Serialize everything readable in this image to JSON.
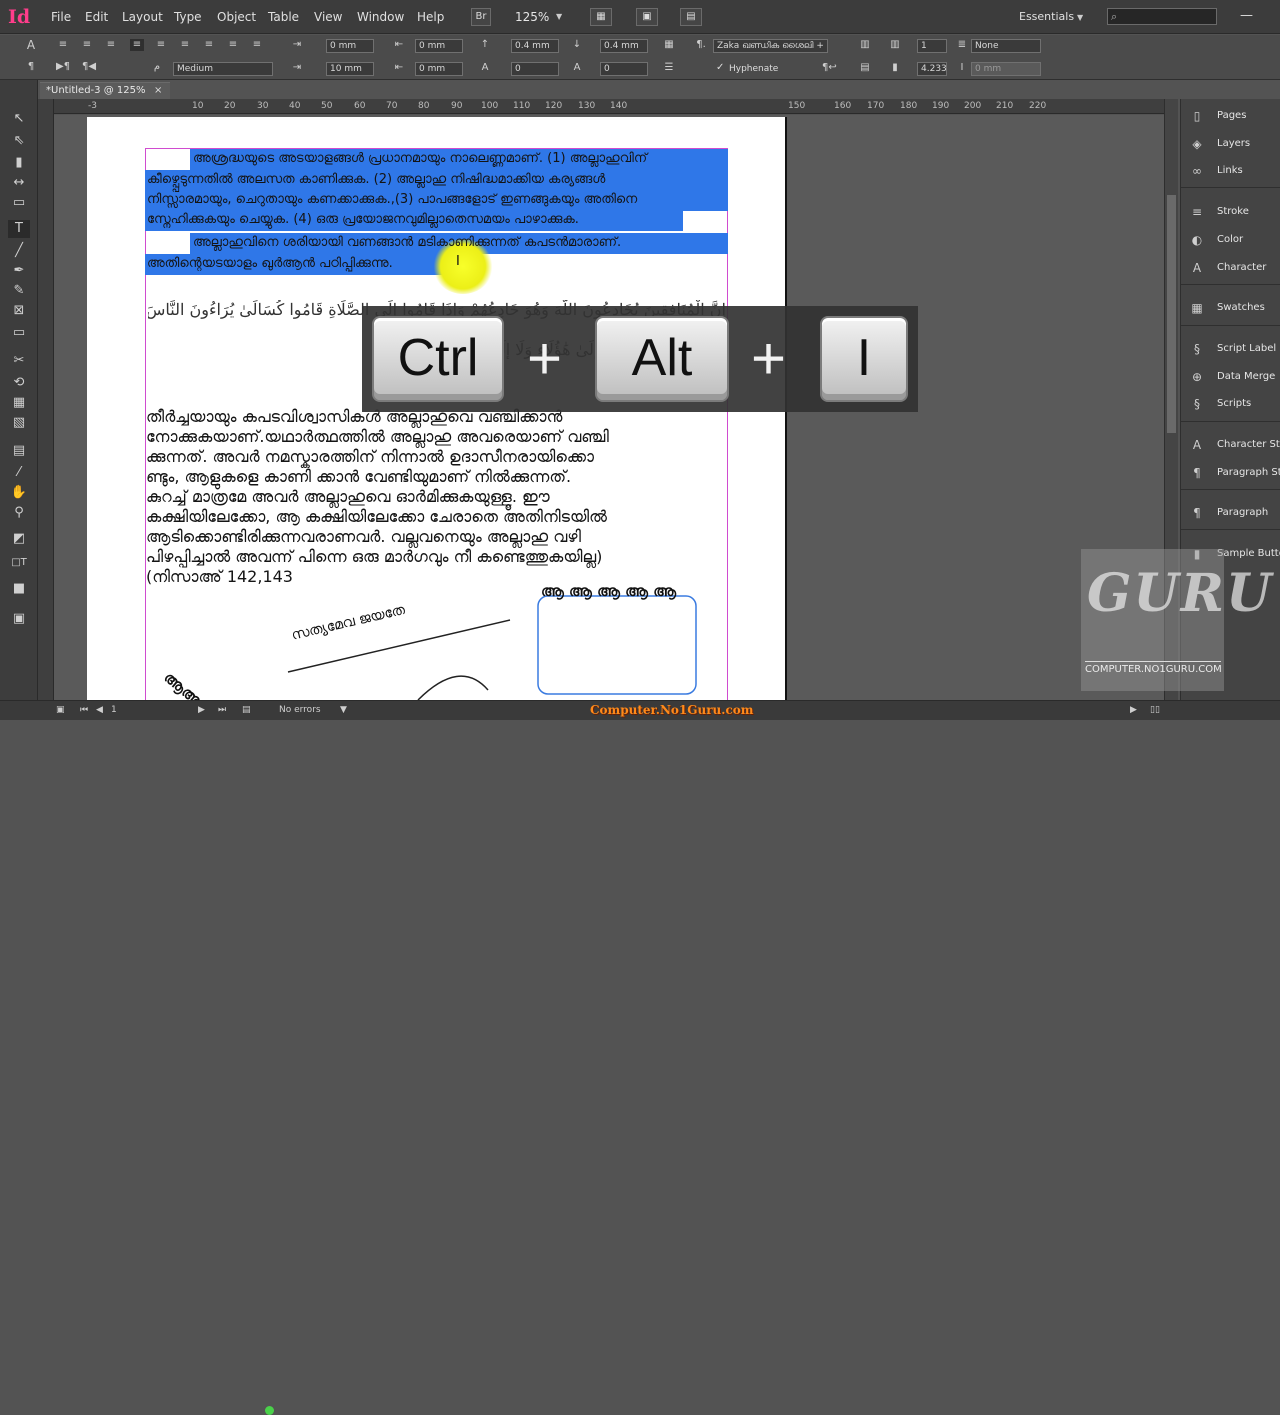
{
  "menubar": {
    "app_icon": "Id",
    "items": [
      "File",
      "Edit",
      "Layout",
      "Type",
      "Object",
      "Table",
      "View",
      "Window",
      "Help"
    ],
    "bridge_label": "Br",
    "zoom": "125%",
    "workspace": "Essentials"
  },
  "control_panel": {
    "font_style": "Medium",
    "left_indent": "0 mm",
    "right_indent": "0 mm",
    "first_line_indent": "10 mm",
    "last_line_indent": "0 mm",
    "space_before": "0.4 mm",
    "space_after": "0.4 mm",
    "drop_cap_lines": "0",
    "drop_cap_chars": "0",
    "paragraph_style": "Zaka ഖണ്ഡിക ശൈലി +",
    "hyphenate_label": "Hyphenate",
    "columns": "1",
    "gutter": "4.233",
    "span_mode": "None",
    "span_value": "0 mm"
  },
  "document": {
    "tab_title": "*Untitled-3 @ 125%",
    "ruler_ticks": [
      "-3",
      "10",
      "20",
      "30",
      "40",
      "50",
      "60",
      "70",
      "80",
      "90",
      "100",
      "110",
      "120",
      "130",
      "140",
      "150",
      "160",
      "170",
      "180",
      "190",
      "200",
      "210",
      "220"
    ]
  },
  "page_text": {
    "selected_lines": [
      "അശ്രദ്ധയുടെ അടയാളങ്ങൾ പ്രധാനമായും നാലെണ്ണമാണ്. (1) അല്ലാഹുവിന്",
      "കീഴ്പ്പെടുന്നതിൽ അലസത കാണിക്കുക. (2) അല്ലാഹു നിഷിദ്ധമാക്കിയ കര്യങ്ങൾ",
      "നിസ്സാരമായും, ചെറുതായും കണക്കാക്കുക.,(3) പാപങ്ങളോട് ഇണങ്ങുകയും അതിനെ",
      "സ്നേഹിക്കുകയും ചെയ്യുക. (4) ഒരു പ്രയോജനവുമില്ലാതെസമയം പാഴാക്കുക.",
      "അല്ലാഹുവിനെ ശരിയായി വണങ്ങാൻ മടികാണിക്കുന്നത് കപടൻമാരാണ്.",
      "അതിന്റെയടയാളം ഖുർആൻ പഠിപ്പിക്കുന്നു."
    ],
    "arabic_lines": [
      "إِنَّ الْمُنَافِقِينَ يُخَادِعُونَ اللَّهَ وَهُوَ خَادِعُهُمْ وَإِذَا قَامُوا إِلَى الصَّلَاةِ قَامُوا كُسَالَىٰ يُرَاءُونَ النَّاسَ وَلَا",
      "مُّذَبْذَبِينَ بَيْنَ ذَٰلِكَ لَا إِلَىٰ هَٰؤُلَاءِ وَلَا إِلَىٰ هَٰؤُلَاءِ وَمَن يُضْلِلِ"
    ],
    "body_lines": [
      "തീർച്ചയായും കപടവിശ്വാസികൾ അല്ലാഹുവെ വഞ്ചിക്കാൻ",
      "നോക്കുകയാണ്.യഥാർത്ഥത്തിൽ അല്ലാഹു അവരെയാണ് വഞ്ചി",
      "ക്കുന്നത്. അവർ നമസ്കാരത്തിന് നിന്നാൽ ഉദാസീനരായിക്കൊ",
      "ണ്ടും, ആളുകളെ കാണി ക്കാൻ വേണ്ടിയുമാണ് നിൽക്കുന്നത്.",
      "കുറച്ച് മാത്രമേ അവർ അല്ലാഹുവെ ഓർമിക്കുകയുള്ളൂ. ഈ",
      "കക്ഷിയിലേക്കോ, ആ കക്ഷിയിലേക്കോ ചേരാതെ അതിനിടയിൽ",
      "ആടിക്കൊണ്ടിരിക്കുന്നവരാണവർ. വല്ലവനെയും അല്ലാഹു വഴി",
      "പിഴപ്പിച്ചാൽ അവന്ന് പിന്നെ ഒരു മാർഗവും നീ കണ്ടെത്തുകയില്ല)",
      "(നിസാഅ് 142,143"
    ],
    "path_text_1": "സത്യമേവ ജയതേ",
    "path_text_2": "ആ ആ ആ ആ ആ",
    "path_text_3": "ആആ"
  },
  "overlay": {
    "keys": [
      "Ctrl",
      "Alt",
      "I"
    ],
    "plus": "+"
  },
  "panels": [
    {
      "icon": "pages-icon",
      "label": "Pages"
    },
    {
      "icon": "layers-icon",
      "label": "Layers"
    },
    {
      "icon": "links-icon",
      "label": "Links"
    },
    {
      "icon": "stroke-icon",
      "label": "Stroke"
    },
    {
      "icon": "color-icon",
      "label": "Color"
    },
    {
      "icon": "character-icon",
      "label": "Character"
    },
    {
      "icon": "swatches-icon",
      "label": "Swatches"
    },
    {
      "icon": "script-label-icon",
      "label": "Script Label"
    },
    {
      "icon": "data-merge-icon",
      "label": "Data Merge"
    },
    {
      "icon": "scripts-icon",
      "label": "Scripts"
    },
    {
      "icon": "character-styles-icon",
      "label": "Character Styl"
    },
    {
      "icon": "paragraph-styles-icon",
      "label": "Paragraph Sty"
    },
    {
      "icon": "paragraph-icon",
      "label": "Paragraph"
    },
    {
      "icon": "sample-buttons-icon",
      "label": "Sample Butto"
    }
  ],
  "watermark": {
    "logo_text": "GURU",
    "site": "COMPUTER.NO1GURU.COM"
  },
  "statusbar": {
    "page_number": "1",
    "errors": "No errors",
    "caption": "Computer.No1Guru.com"
  },
  "colors": {
    "selection": "#2f77e8",
    "cursor_highlight": "#f5fb1e",
    "app_accent": "#ff3d8b"
  }
}
